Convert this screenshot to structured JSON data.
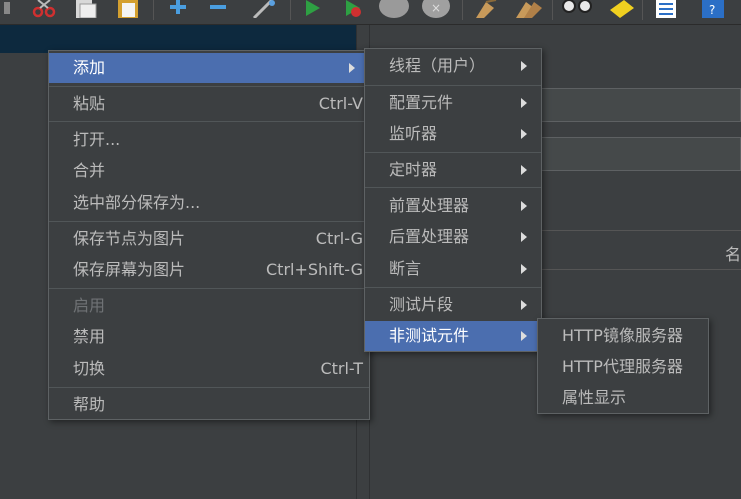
{
  "context_menu": {
    "items": [
      {
        "label": "添加",
        "accel": "",
        "submenu": true,
        "selected": true
      },
      {
        "label": "粘贴",
        "accel": "Ctrl-V"
      },
      {
        "label": "打开...",
        "accel": ""
      },
      {
        "label": "合并",
        "accel": ""
      },
      {
        "label": "选中部分保存为...",
        "accel": ""
      },
      {
        "label": "保存节点为图片",
        "accel": "Ctrl-G"
      },
      {
        "label": "保存屏幕为图片",
        "accel": "Ctrl+Shift-G"
      },
      {
        "label": "启用",
        "accel": "",
        "disabled": true
      },
      {
        "label": "禁用",
        "accel": ""
      },
      {
        "label": "切换",
        "accel": "Ctrl-T"
      },
      {
        "label": "帮助",
        "accel": ""
      }
    ]
  },
  "add_submenu": {
    "items": [
      {
        "label": "线程（用户）",
        "submenu": true
      },
      {
        "label": "配置元件",
        "submenu": true
      },
      {
        "label": "监听器",
        "submenu": true
      },
      {
        "label": "定时器",
        "submenu": true
      },
      {
        "label": "前置处理器",
        "submenu": true
      },
      {
        "label": "后置处理器",
        "submenu": true
      },
      {
        "label": "断言",
        "submenu": true
      },
      {
        "label": "测试片段",
        "submenu": true
      },
      {
        "label": "非测试元件",
        "submenu": true,
        "selected": true
      }
    ]
  },
  "non_test_submenu": {
    "items": [
      {
        "label": "HTTP镜像服务器"
      },
      {
        "label": "HTTP代理服务器"
      },
      {
        "label": "属性显示"
      }
    ]
  },
  "right_panel": {
    "table_header_partial": "名"
  },
  "colors": {
    "selection": "#4b6eaf",
    "menu_bg": "#3c3f41",
    "tree_selection": "#0d293e"
  },
  "toolbar_icons": [
    "cut-icon",
    "copy-icon",
    "paste-icon",
    "expand-icon",
    "collapse-icon",
    "toggle-icon",
    "start-icon",
    "start-no-pause-icon",
    "stop-icon",
    "shutdown-icon",
    "clear-icon",
    "clear-all-icon",
    "search-icon",
    "reset-search-icon",
    "function-helper-icon",
    "help-icon"
  ]
}
